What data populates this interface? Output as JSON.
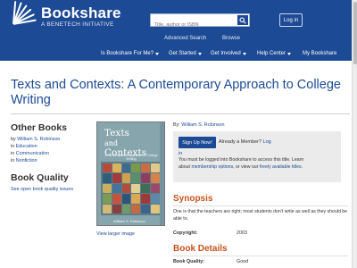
{
  "brand": {
    "name": "Bookshare",
    "tagline": "A BENETECH INITIATIVE"
  },
  "search": {
    "placeholder": "Title, author or ISBN"
  },
  "header": {
    "login_label": "Log in",
    "advanced_search": "Advanced Search",
    "browse": "Browse"
  },
  "nav": {
    "items": [
      {
        "label": "Is Bookshare For Me?"
      },
      {
        "label": "Get Started"
      },
      {
        "label": "Get Involved"
      },
      {
        "label": "Help Center"
      },
      {
        "label": "My Bookshare"
      }
    ]
  },
  "book": {
    "title": "Texts and Contexts: A Contemporary Approach to College Writing",
    "by_label": "By:",
    "author": "William S. Robinson",
    "cover": {
      "title_line1": "Texts",
      "title_line2": "and",
      "title_line3": "Contexts",
      "subtitle": "A Contemporary Approach to College Writing",
      "author": "William S. Robinson"
    },
    "view_larger": "View larger image"
  },
  "other_books": {
    "heading": "Other Books",
    "by_prefix": "by",
    "by_value": "William S. Robinson",
    "in_prefix": "in",
    "categories": [
      "Education",
      "Communication",
      "Nonfiction"
    ]
  },
  "book_quality_sidebar": {
    "heading": "Book Quality",
    "link": "See open book quality issues"
  },
  "signup": {
    "button": "Sign Up Now!",
    "already_member": "Already a Member?",
    "login_link": "Log",
    "login_link_cont": "in",
    "note_1": "You must be logged into Bookshare to",
    "note_2": "access this title. Learn about",
    "note_link_1": "membership",
    "note_3": "options",
    "note_4": ", or view our",
    "note_link_2": "freely available titles",
    "note_5": "."
  },
  "synopsis": {
    "heading": "Synopsis",
    "text": "One is that the teachers are right; most students don't write as well as they should be able to."
  },
  "details": {
    "copyright_label": "Copyright:",
    "copyright_value": "2003",
    "heading": "Book Details",
    "quality_label": "Book Quality:",
    "quality_value": "Good"
  },
  "colors": {
    "brand_blue": "#1d4a94",
    "accent_orange": "#c8531c",
    "panel_gray": "#ebebeb"
  }
}
